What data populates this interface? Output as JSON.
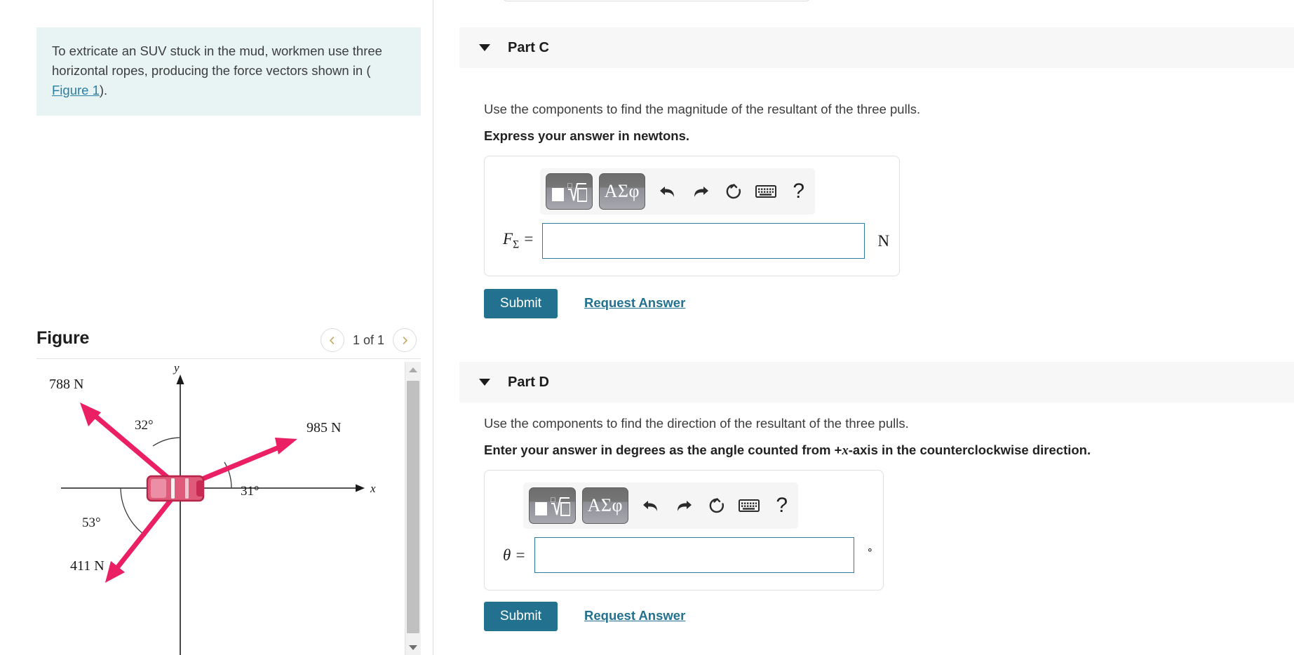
{
  "problem": {
    "text_line1": "To extricate an SUV stuck in the mud, workmen use three",
    "text_line2": "horizontal ropes, producing the force vectors shown in (",
    "figure_link": "Figure 1",
    "text_tail": ")."
  },
  "figure_panel": {
    "title": "Figure",
    "pager_label": "1 of 1",
    "prev_icon": "chevron-left-icon",
    "next_icon": "chevron-right-icon",
    "scrollbar": {
      "up_icon": "scroll-up-arrow-icon",
      "down_icon": "scroll-down-arrow-icon"
    }
  },
  "chart_data": {
    "type": "diagram",
    "title": "Force vectors on SUV",
    "axis_labels": {
      "x": "x",
      "y": "y"
    },
    "vectors": [
      {
        "label": "788 N",
        "magnitude": 788,
        "unit": "N",
        "angle_from_plus_y_deg": 32,
        "angle_label": "32°",
        "direction": "upper-left",
        "angle_standard_deg": 122
      },
      {
        "label": "985 N",
        "magnitude": 985,
        "unit": "N",
        "angle_from_plus_x_deg": 31,
        "angle_label": "31°",
        "direction": "upper-right",
        "angle_standard_deg": 31
      },
      {
        "label": "411 N",
        "magnitude": 411,
        "unit": "N",
        "angle_from_minus_x_deg": 53,
        "angle_label": "53°",
        "direction": "lower-left",
        "angle_standard_deg": 233
      }
    ],
    "vector_color": "#eb1f63",
    "object": "SUV (top view)"
  },
  "parts": [
    {
      "id": "part-c",
      "header": "Part C",
      "caret_icon": "caret-down-icon",
      "prompt": "Use the components to find the magnitude of the resultant of the three pulls.",
      "instruction": "Express your answer in newtons.",
      "toolbar": {
        "template_btn_icon": "math-template-icon",
        "greek_btn_label": "ΑΣφ",
        "undo_icon": "undo-arrow-icon",
        "redo_icon": "redo-arrow-icon",
        "reset_icon": "reset-circular-arrow-icon",
        "keyboard_icon": "keyboard-icon",
        "help_label": "?"
      },
      "field": {
        "var_main": "F",
        "var_sub": "Σ",
        "equals": "=",
        "value": "",
        "placeholder": "",
        "unit": "N"
      },
      "submit_label": "Submit",
      "request_answer_label": "Request Answer"
    },
    {
      "id": "part-d",
      "header": "Part D",
      "caret_icon": "caret-down-icon",
      "prompt": "Use the components to find the direction of the resultant of the three pulls.",
      "instruction_pre": "Enter your answer in degrees as the angle counted from +",
      "instruction_var": "x",
      "instruction_post": "-axis in the counterclockwise direction.",
      "toolbar": {
        "template_btn_icon": "math-template-icon",
        "greek_btn_label": "ΑΣφ",
        "undo_icon": "undo-arrow-icon",
        "redo_icon": "redo-arrow-icon",
        "reset_icon": "reset-circular-arrow-icon",
        "keyboard_icon": "keyboard-icon",
        "help_label": "?"
      },
      "field": {
        "var_main": "θ",
        "equals": "=",
        "value": "",
        "placeholder": "",
        "unit": "∘"
      },
      "submit_label": "Submit",
      "request_answer_label": "Request Answer"
    }
  ],
  "colors": {
    "accent": "#21718f",
    "problem_bg": "#e8f4f4",
    "part_header_bg": "#f7f7f7",
    "input_border": "#2f7c9e",
    "vector": "#eb1f63"
  }
}
